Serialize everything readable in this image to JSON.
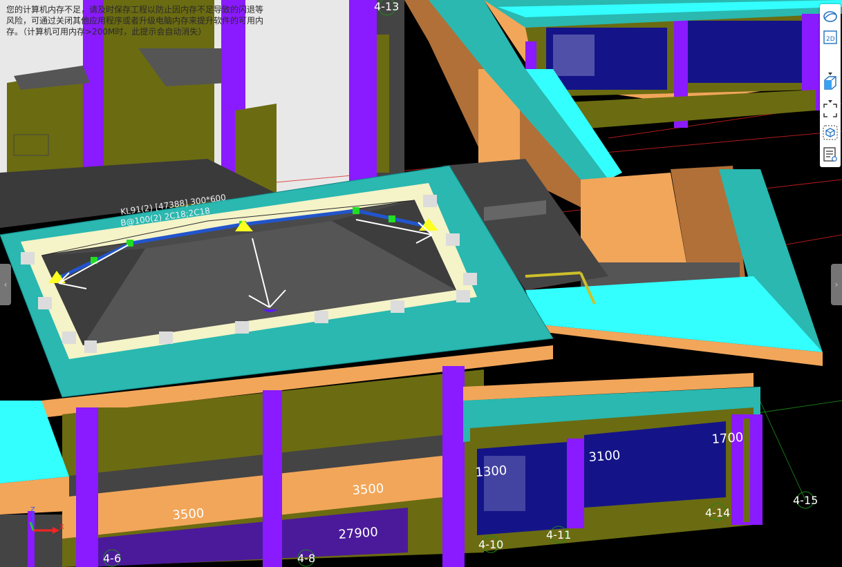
{
  "warning": {
    "text": "您的计算机内存不足，请及时保存工程以防止因内存不足导致的闪退等风险，可通过关闭其他应用程序或者升级电脑内存来提升软件的可用内存。（计算机可用内存>200M时，此提示会自动消失）"
  },
  "annotation": {
    "line1": "KL91(2) [47388] 300*600",
    "line2": "B@100(2) 2C18;2C18"
  },
  "dimensions": {
    "d3500_left": "3500",
    "d3500_right": "3500",
    "d27900": "27900",
    "d1300": "1300",
    "d3100": "3100",
    "d1700": "1700"
  },
  "axes": {
    "a4_6": "4-6",
    "a4_8": "4-8",
    "a4_10": "4-10",
    "a4_11": "4-11",
    "a4_13": "4-13",
    "a4_14": "4-14",
    "a4_15": "4-15"
  },
  "toolbar": {
    "icons": [
      "orbit-icon",
      "2d-view-icon",
      "3d-box-icon",
      "fit-view-icon",
      "view-cube-icon",
      "properties-list-icon"
    ],
    "label_2d": "2D"
  },
  "colors": {
    "cyan": "#33ffff",
    "teal": "#2ab8b0",
    "orange": "#f2a65a",
    "purple": "#8a1aff",
    "olive": "#6b6b12",
    "slab_gray": "#4a4a4a",
    "navy": "#141488",
    "background": "#000000"
  }
}
